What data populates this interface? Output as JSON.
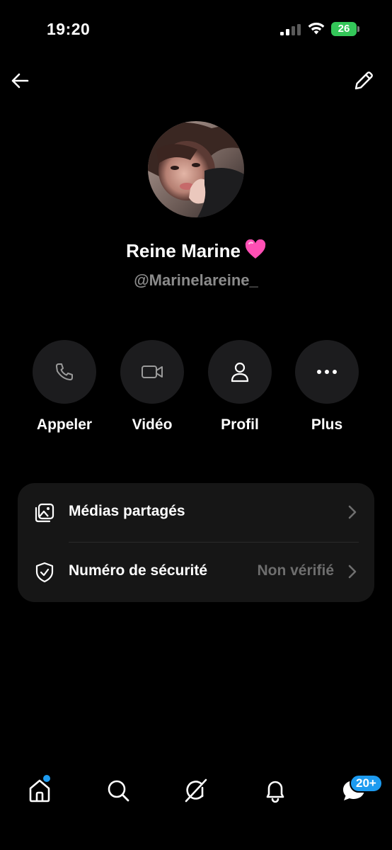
{
  "status_bar": {
    "time": "19:20",
    "battery_level": "26",
    "battery_color": "#34c759"
  },
  "header": {
    "back_icon": "arrow-left-icon",
    "edit_icon": "pencil-icon"
  },
  "profile": {
    "display_name": "Reine Marine",
    "name_emoji": "pink-heart-icon",
    "handle": "@Marinelareine_"
  },
  "actions": [
    {
      "label": "Appeler",
      "icon": "phone-icon"
    },
    {
      "label": "Vidéo",
      "icon": "video-camera-icon"
    },
    {
      "label": "Profil",
      "icon": "person-icon"
    },
    {
      "label": "Plus",
      "icon": "more-dots-icon"
    }
  ],
  "info_rows": [
    {
      "label": "Médias partagés",
      "value": "",
      "icon": "shared-media-icon"
    },
    {
      "label": "Numéro de sécurité",
      "value": "Non vérifié",
      "icon": "shield-check-icon"
    }
  ],
  "tab_bar": {
    "tabs": [
      {
        "icon": "home-icon"
      },
      {
        "icon": "search-icon"
      },
      {
        "icon": "grok-icon"
      },
      {
        "icon": "bell-icon"
      },
      {
        "icon": "messages-icon"
      }
    ],
    "messages_badge": "20+",
    "accent_color": "#1d9bf0"
  }
}
